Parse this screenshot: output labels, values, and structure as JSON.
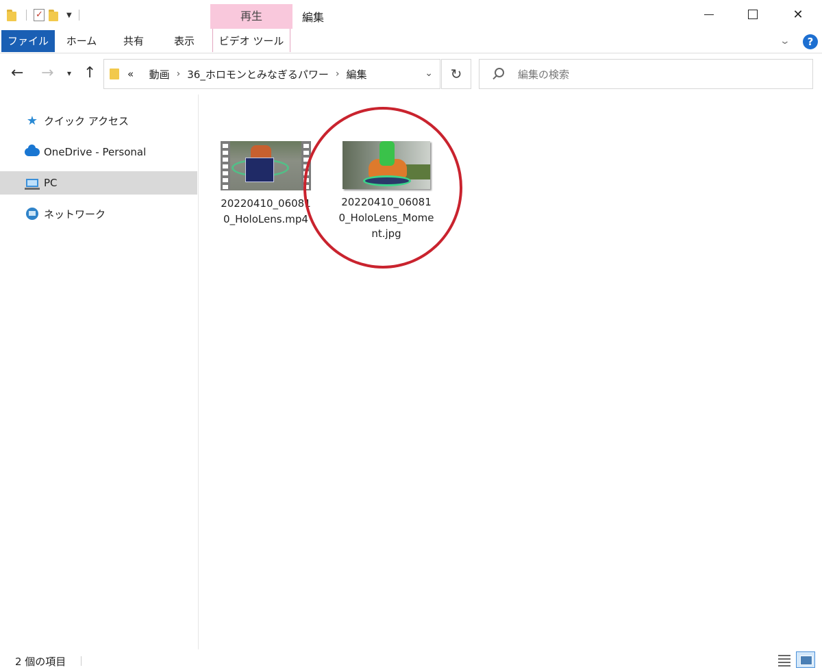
{
  "titlebar": {
    "context_tab": "再生",
    "window_title": "編集"
  },
  "ribbon": {
    "tabs": [
      "ファイル",
      "ホーム",
      "共有",
      "表示",
      "ビデオ ツール"
    ],
    "help": "?"
  },
  "address": {
    "overflow": "«",
    "crumbs": [
      "動画",
      "36_ホロモンとみなぎるパワー",
      "編集"
    ]
  },
  "search": {
    "placeholder": "編集の検索"
  },
  "sidebar": {
    "items": [
      {
        "label": "クイック アクセス",
        "icon": "star-icon"
      },
      {
        "label": "OneDrive - Personal",
        "icon": "onedrive-cloud-icon"
      },
      {
        "label": "PC",
        "icon": "pc-icon",
        "selected": true
      },
      {
        "label": "ネットワーク",
        "icon": "network-icon"
      }
    ]
  },
  "files": [
    {
      "name": "20220410_060810_HoloLens.mp4",
      "type": "video"
    },
    {
      "name": "20220410_060810_HoloLens_Moment.jpg",
      "type": "image",
      "highlighted": true
    }
  ],
  "status": {
    "item_count": "2 個の項目"
  },
  "colors": {
    "file_tab": "#1a5fb4",
    "context_tab": "#f9c8dc",
    "highlight": "#c9232e",
    "selected_item": "#d9d9d9"
  }
}
